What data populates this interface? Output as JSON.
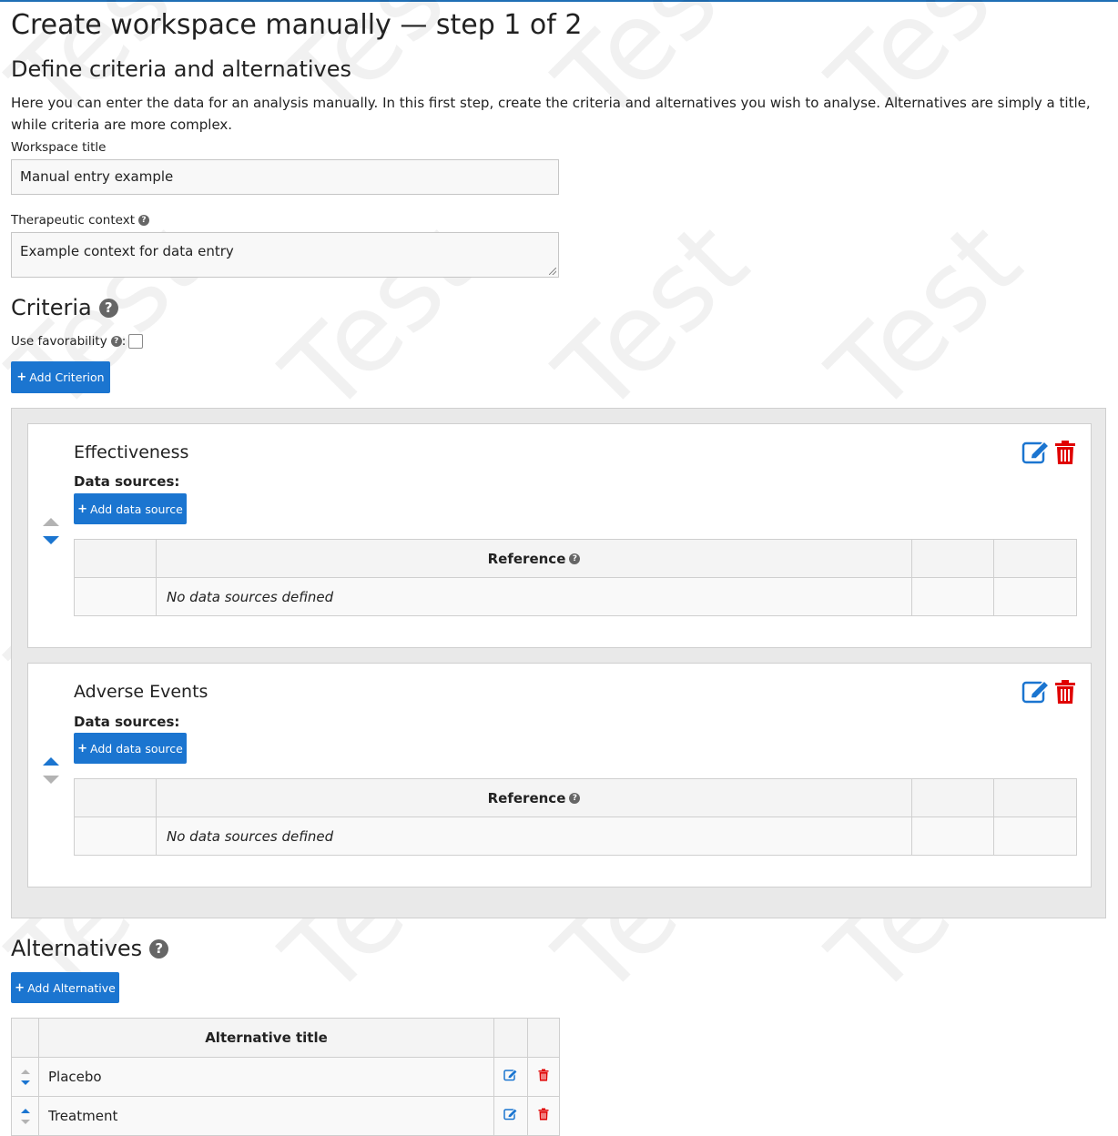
{
  "watermark_text": "Test",
  "page": {
    "title": "Create workspace manually — step 1 of 2",
    "subtitle": "Define criteria and alternatives",
    "intro": "Here you can enter the data for an analysis manually. In this first step, create the criteria and alternatives you wish to analyse. Alternatives are simply a title, while criteria are more complex."
  },
  "workspace": {
    "title_label": "Workspace title",
    "title_value": "Manual entry example",
    "context_label": "Therapeutic context",
    "context_value": "Example context for data entry"
  },
  "criteria": {
    "heading": "Criteria",
    "favorability_label": "Use favorability",
    "favorability_checked": false,
    "add_button": "Add Criterion",
    "items": [
      {
        "title": "Effectiveness",
        "data_sources_label": "Data sources:",
        "add_source_button": "Add data source",
        "table_header": "Reference",
        "empty_text": "No data sources defined",
        "move_up_enabled": false,
        "move_down_enabled": true
      },
      {
        "title": "Adverse Events",
        "data_sources_label": "Data sources:",
        "add_source_button": "Add data source",
        "table_header": "Reference",
        "empty_text": "No data sources defined",
        "move_up_enabled": true,
        "move_down_enabled": false
      }
    ]
  },
  "alternatives": {
    "heading": "Alternatives",
    "add_button": "Add Alternative",
    "column_header": "Alternative title",
    "rows": [
      {
        "title": "Placebo",
        "move_up_enabled": false,
        "move_down_enabled": true
      },
      {
        "title": "Treatment",
        "move_up_enabled": true,
        "move_down_enabled": false
      }
    ]
  },
  "colors": {
    "primary": "#1b75d0",
    "danger": "#e00000",
    "disabled_arrow": "#b3b3b3"
  }
}
